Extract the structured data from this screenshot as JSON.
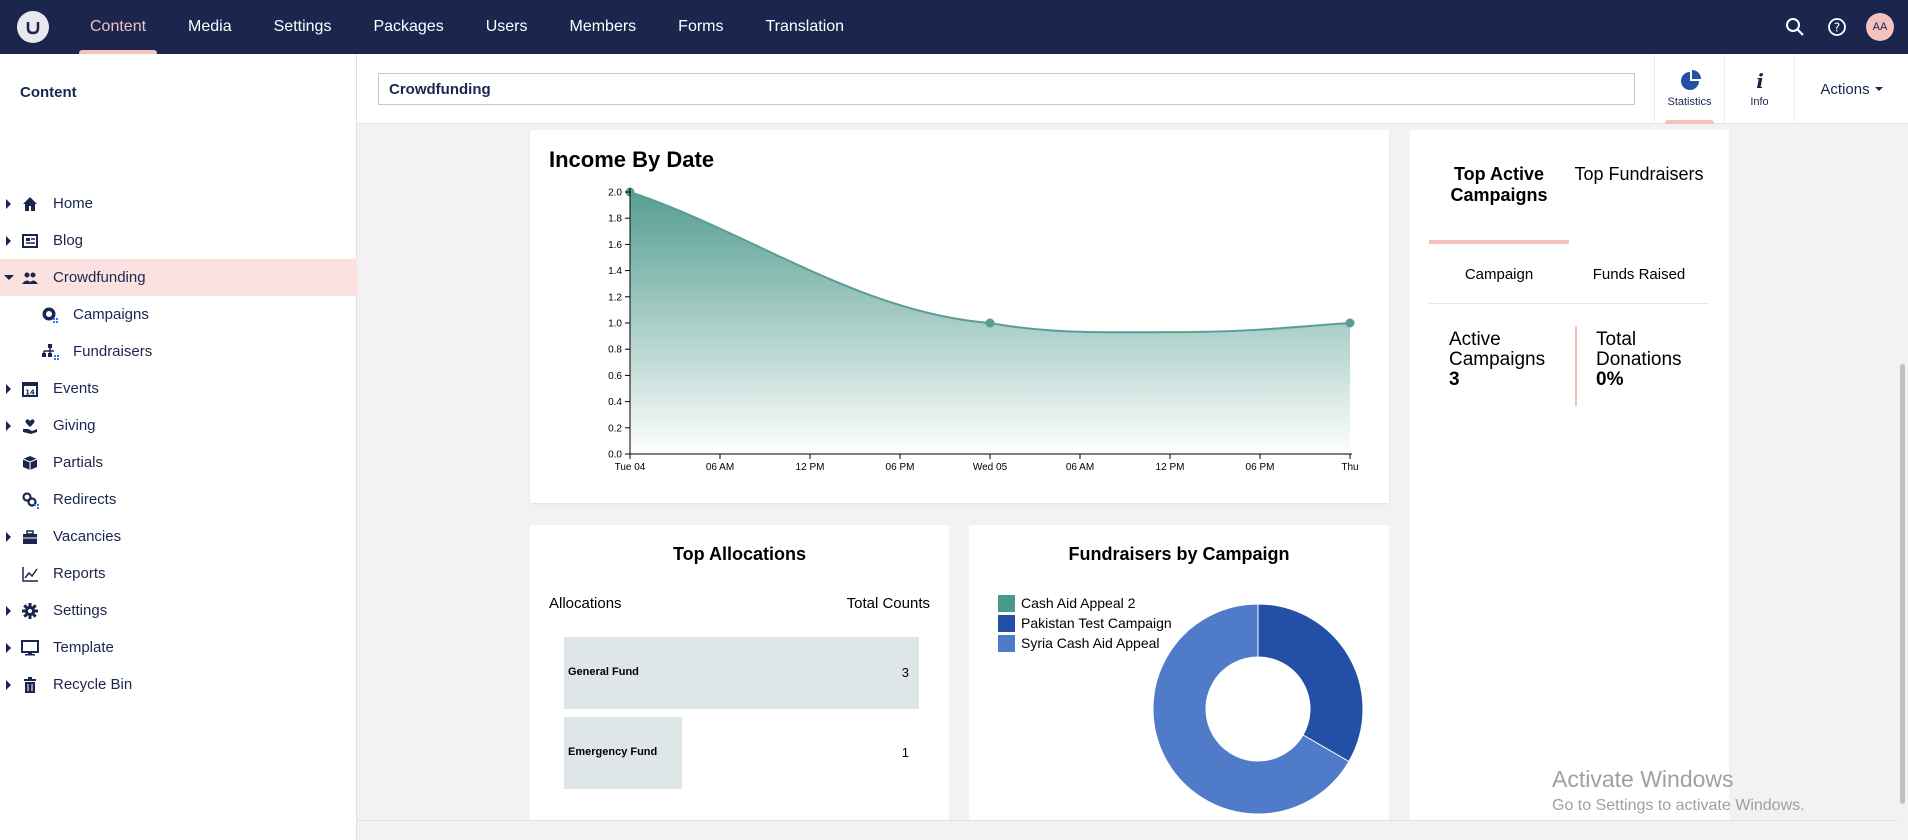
{
  "topnav": {
    "items": [
      "Content",
      "Media",
      "Settings",
      "Packages",
      "Users",
      "Members",
      "Forms",
      "Translation"
    ],
    "active": "Content",
    "avatar_initials": "AA",
    "icons": [
      "search-icon",
      "help-icon"
    ]
  },
  "sidebar": {
    "title": "Content",
    "items": [
      {
        "label": "Home",
        "icon": "home-icon"
      },
      {
        "label": "Blog",
        "icon": "newspaper-icon"
      },
      {
        "label": "Crowdfunding",
        "icon": "people-icon",
        "selected": true,
        "expanded": true
      },
      {
        "label": "Campaigns",
        "icon": "globe-icon"
      },
      {
        "label": "Fundraisers",
        "icon": "sitemap-icon"
      },
      {
        "label": "Events",
        "icon": "calendar-icon"
      },
      {
        "label": "Giving",
        "icon": "hand-heart-icon"
      },
      {
        "label": "Partials",
        "icon": "box-icon"
      },
      {
        "label": "Redirects",
        "icon": "link-icon"
      },
      {
        "label": "Vacancies",
        "icon": "briefcase-icon"
      },
      {
        "label": "Reports",
        "icon": "chart-line-icon"
      },
      {
        "label": "Settings",
        "icon": "gear-icon"
      },
      {
        "label": "Template",
        "icon": "monitor-icon"
      },
      {
        "label": "Recycle Bin",
        "icon": "trash-icon"
      }
    ]
  },
  "header": {
    "node_name": "Crowdfunding",
    "apps": [
      {
        "label": "Statistics",
        "icon": "pie-chart-icon",
        "active": true
      },
      {
        "label": "Info",
        "icon": "info-icon"
      }
    ],
    "actions_label": "Actions"
  },
  "income": {
    "title": "Income By Date",
    "chart_data": {
      "type": "area",
      "title": "Income By Date",
      "x_ticks": [
        "Tue 04",
        "06 AM",
        "12 PM",
        "06 PM",
        "Wed 05",
        "06 AM",
        "12 PM",
        "06 PM",
        "Thu"
      ],
      "y_ticks": [
        "2.0",
        "1.8",
        "1.6",
        "1.4",
        "1.2",
        "1.0",
        "0.8",
        "0.6",
        "0.4",
        "0.2",
        "0.0"
      ],
      "ylim": [
        0,
        2
      ],
      "points": [
        {
          "x": "Tue 04",
          "y": 2
        },
        {
          "x": "Wed 05",
          "y": 1
        },
        {
          "x": "Thu 06",
          "y": 1
        }
      ],
      "color": "#5a9e93"
    }
  },
  "top_active": {
    "tabs": [
      "Top Active Campaigns",
      "Top Fundraisers"
    ],
    "active_tab": "Top Active Campaigns",
    "columns": [
      "Campaign",
      "Funds Raised"
    ],
    "stats": [
      {
        "label": "Active Campaigns",
        "value": "3"
      },
      {
        "label": "Total Donations",
        "value": "0%"
      }
    ]
  },
  "allocations": {
    "title": "Top Allocations",
    "headers": [
      "Allocations",
      "Total Counts"
    ],
    "rows": [
      {
        "name": "General Fund",
        "count": 3
      },
      {
        "name": "Emergency Fund",
        "count": 1
      }
    ]
  },
  "fundraisers": {
    "title": "Fundraisers by Campaign",
    "chart_data": {
      "type": "pie",
      "title": "Fundraisers by Campaign",
      "slices": [
        {
          "name": "Cash Aid Appeal 2",
          "value": 0,
          "color": "#4a9a8c"
        },
        {
          "name": "Pakistan Test Campaign",
          "value": 1,
          "color": "#2350a6"
        },
        {
          "name": "Syria Cash Aid Appeal",
          "value": 2,
          "color": "#4f7bc8"
        }
      ]
    }
  },
  "watermark": {
    "line1": "Activate Windows",
    "line2": "Go to Settings to activate Windows."
  }
}
